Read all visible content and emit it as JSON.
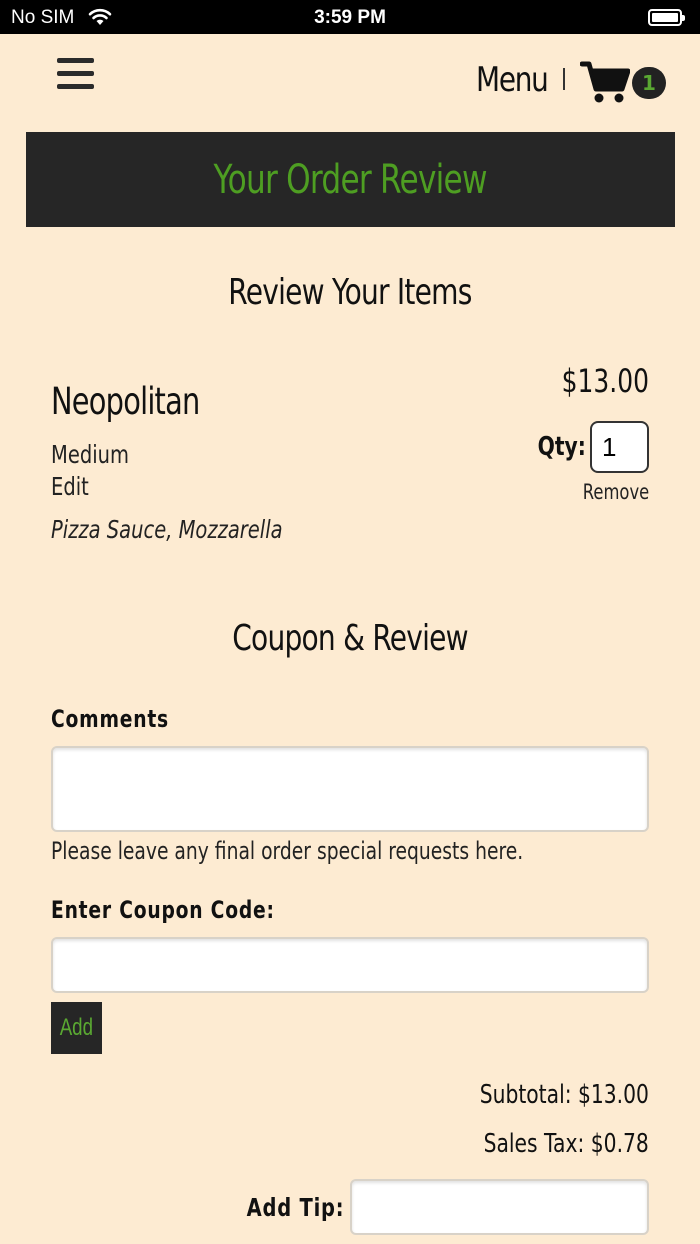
{
  "status_bar": {
    "carrier": "No SIM",
    "time": "3:59 PM"
  },
  "header": {
    "menu_label": "Menu",
    "cart_count": "1"
  },
  "banner": {
    "title": "Your Order Review"
  },
  "review": {
    "heading": "Review Your Items",
    "item": {
      "name": "Neopolitan",
      "size": "Medium",
      "edit_label": "Edit",
      "toppings": "Pizza Sauce, Mozzarella",
      "price": "$13.00",
      "qty_label": "Qty:",
      "qty_value": "1",
      "remove_label": "Remove"
    }
  },
  "coupon": {
    "heading": "Coupon & Review",
    "comments_label": "Comments",
    "comments_value": "",
    "comments_helper": "Please leave any final order special requests here.",
    "coupon_label": "Enter Coupon Code:",
    "coupon_value": "",
    "add_label": "Add"
  },
  "summary": {
    "subtotal": "Subtotal: $13.00",
    "sales_tax": "Sales Tax: $0.78",
    "tip_label": "Add Tip:",
    "tip_value": ""
  },
  "colors": {
    "background": "#fdebd2",
    "banner": "#262626",
    "accent_green": "#4e9e22"
  }
}
